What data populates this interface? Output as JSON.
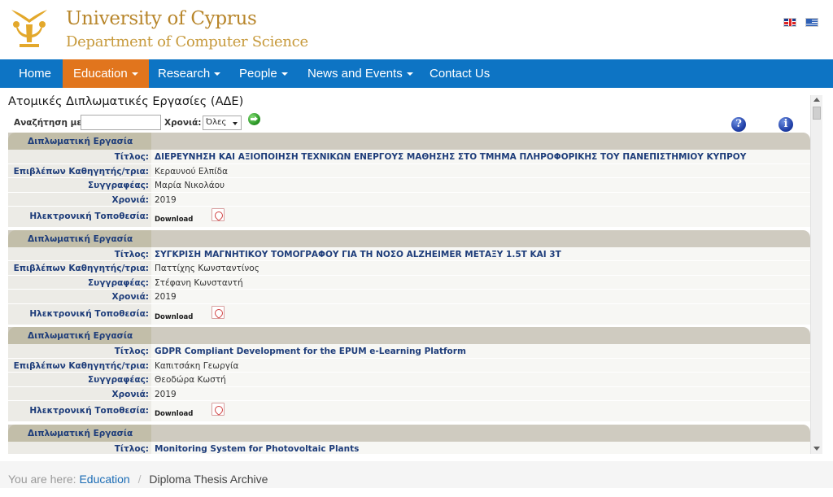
{
  "header": {
    "university": "University of Cyprus",
    "department": "Department of Computer Science",
    "languages": [
      {
        "name": "english-flag-icon"
      },
      {
        "name": "greek-flag-icon"
      }
    ]
  },
  "nav": {
    "items": [
      {
        "label": "Home",
        "dropdown": false
      },
      {
        "label": "Education",
        "dropdown": true,
        "active": true
      },
      {
        "label": "Research",
        "dropdown": true
      },
      {
        "label": "People",
        "dropdown": true
      },
      {
        "label": "News and Events",
        "dropdown": true
      },
      {
        "label": "Contact Us",
        "dropdown": false
      }
    ]
  },
  "page": {
    "title": "Ατομικές Διπλωματικές Εργασίες (ΑΔΕ)"
  },
  "search": {
    "label": "Αναζήτηση με",
    "value": "",
    "year_label": "Χρονιά:",
    "year_selected": "Όλες"
  },
  "labels": {
    "record_header": "Διπλωματική Εργασία",
    "title": "Τίτλος:",
    "supervisor": "Επιβλέπων Καθηγητής/τρια:",
    "author": "Συγγραφέας:",
    "year": "Χρονιά:",
    "location": "Ηλεκτρονική Τοποθεσία:",
    "download": "Download"
  },
  "records": [
    {
      "title": "ΔΙΕΡΕΥΝΗΣΗ ΚΑΙ ΑΞΙΟΠΟΙΗΣΗ ΤΕΧΝΙΚΩΝ ΕΝΕΡΓΟΥΣ ΜΑΘΗΣΗΣ ΣΤΟ ΤΜΗΜΑ ΠΛΗΡΟΦΟΡΙΚΗΣ ΤΟΥ ΠΑΝΕΠΙΣΤΗΜΙΟΥ ΚΥΠΡΟΥ",
      "supervisor": "Κεραυνού Ελπίδα",
      "author": "Μαρία Νικολάου",
      "year": "2019"
    },
    {
      "title": "ΣΥΓΚΡΙΣΗ ΜΑΓΝΗΤΙΚΟΥ ΤΟΜΟΓΡΑΦΟΥ ΓΙΑ ΤΗ ΝΟΣΟ ALZHEIMER ΜΕΤΑΞΥ 1.5T ΚΑΙ 3T",
      "supervisor": "Παττίχης Κωνσταντίνος",
      "author": "Στέφανη Κωνσταντή",
      "year": "2019"
    },
    {
      "title": "GDPR Compliant Development for the EPUM e-Learning Platform",
      "supervisor": "Καπιτσάκη Γεωργία",
      "author": "Θεοδώρα Κωστή",
      "year": "2019"
    },
    {
      "title": "Monitoring System for Photovoltaic Plants",
      "supervisor": "",
      "author": "",
      "year": ""
    }
  ],
  "breadcrumb": {
    "prefix": "You are here:",
    "link": "Education",
    "separator": "/",
    "current": "Diploma Thesis Archive"
  }
}
